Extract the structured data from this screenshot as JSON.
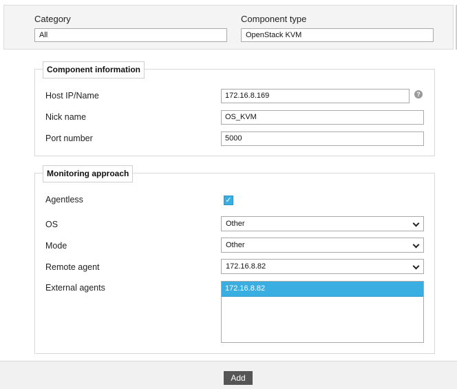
{
  "top": {
    "category_label": "Category",
    "category_value": "All",
    "component_type_label": "Component type",
    "component_type_value": "OpenStack KVM"
  },
  "component_info": {
    "legend": "Component information",
    "host_label": "Host IP/Name",
    "host_value": "172.16.8.169",
    "help_glyph": "?",
    "nick_label": "Nick name",
    "nick_value": "OS_KVM",
    "port_label": "Port number",
    "port_value": "5000"
  },
  "monitoring": {
    "legend": "Monitoring approach",
    "agentless_label": "Agentless",
    "agentless_checked": true,
    "check_glyph": "✓",
    "os_label": "OS",
    "os_value": "Other",
    "mode_label": "Mode",
    "mode_value": "Other",
    "remote_label": "Remote agent",
    "remote_value": "172.16.8.82",
    "external_label": "External agents",
    "external_options": [
      "172.16.8.82"
    ]
  },
  "footer": {
    "add_label": "Add"
  },
  "colors": {
    "accent": "#3aaee0",
    "button": "#555555"
  },
  "icons": [
    "help-icon",
    "checkbox-check-icon",
    "chevron-down-icon"
  ]
}
